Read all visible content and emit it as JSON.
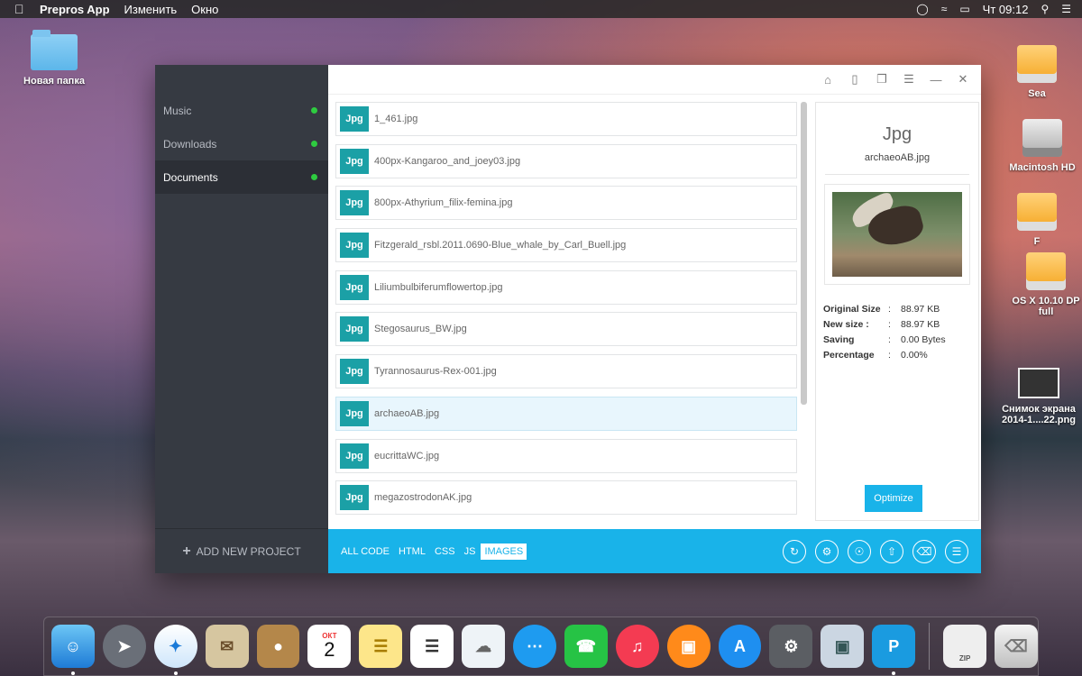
{
  "menubar": {
    "app_name": "Prepros App",
    "items": [
      "Изменить",
      "Окно"
    ],
    "clock": "Чт 09:12"
  },
  "desktop": {
    "icons": [
      {
        "label": "Новая папка"
      },
      {
        "label": "Sea"
      },
      {
        "label": "Macintosh HD"
      },
      {
        "label": "F"
      },
      {
        "label": "OS X 10.10 DP full"
      },
      {
        "label": "Снимок экрана 2014-1....22.png"
      }
    ]
  },
  "sidebar": {
    "projects": [
      {
        "label": "Music"
      },
      {
        "label": "Downloads"
      },
      {
        "label": "Documents"
      }
    ],
    "add_project": "ADD NEW PROJECT"
  },
  "files": [
    {
      "badge": "Jpg",
      "name": "1_461.jpg"
    },
    {
      "badge": "Jpg",
      "name": "400px-Kangaroo_and_joey03.jpg"
    },
    {
      "badge": "Jpg",
      "name": "800px-Athyrium_filix-femina.jpg"
    },
    {
      "badge": "Jpg",
      "name": "Fitzgerald_rsbl.2011.0690-Blue_whale_by_Carl_Buell.jpg"
    },
    {
      "badge": "Jpg",
      "name": "Liliumbulbiferumflowertop.jpg"
    },
    {
      "badge": "Jpg",
      "name": "Stegosaurus_BW.jpg"
    },
    {
      "badge": "Jpg",
      "name": "Tyrannosaurus-Rex-001.jpg"
    },
    {
      "badge": "Jpg",
      "name": "archaeoAB.jpg"
    },
    {
      "badge": "Jpg",
      "name": "eucrittaWC.jpg"
    },
    {
      "badge": "Jpg",
      "name": "megazostrodonAK.jpg"
    }
  ],
  "details": {
    "type": "Jpg",
    "name": "archaeoAB.jpg",
    "stats": [
      {
        "key": "Original Size",
        "value": "88.97 KB"
      },
      {
        "key": "New size :",
        "value": "88.97 KB"
      },
      {
        "key": "Saving",
        "value": "0.00 Bytes"
      },
      {
        "key": "Percentage",
        "value": "0.00%"
      }
    ],
    "optimize_label": "Optimize"
  },
  "filters": [
    "ALL CODE",
    "HTML",
    "CSS",
    "JS",
    "IMAGES"
  ],
  "dock": {
    "calendar_month": "ОКТ",
    "calendar_day": "2",
    "zip_label": "ZIP"
  }
}
